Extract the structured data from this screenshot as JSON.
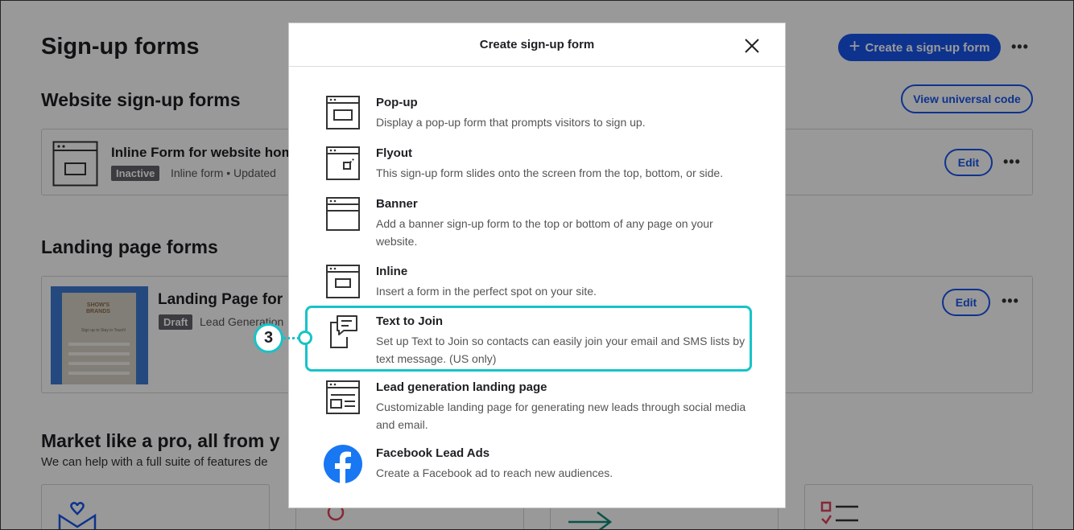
{
  "page": {
    "title": "Sign-up forms",
    "create_button": "Create a sign-up form",
    "more": "•••",
    "website_section": {
      "heading": "Website sign-up forms",
      "view_code_button": "View universal code",
      "form": {
        "name": "Inline Form for website homep",
        "status": "Inactive",
        "meta": "Inline form • Updated",
        "edit": "Edit"
      }
    },
    "landing_section": {
      "heading": "Landing page forms",
      "form": {
        "name": "Landing Page for",
        "status": "Draft",
        "meta": "Lead Generation",
        "edit": "Edit",
        "thumb_title": "SHOW'S\nBRANDS",
        "thumb_text": "Sign up to Stay in Touch!"
      }
    },
    "market": {
      "heading": "Market like a pro, all from y",
      "subtitle": "We can help with a full suite of features de"
    }
  },
  "modal": {
    "title": "Create sign-up form",
    "close_icon": "close-icon",
    "options": [
      {
        "title": "Pop-up",
        "desc": "Display a pop-up form that prompts visitors to sign up.",
        "icon": "popup-icon"
      },
      {
        "title": "Flyout",
        "desc": "This sign-up form slides onto the screen from the top, bottom, or side.",
        "icon": "flyout-icon"
      },
      {
        "title": "Banner",
        "desc": "Add a banner sign-up form to the top or bottom of any page on your website.",
        "icon": "banner-icon"
      },
      {
        "title": "Inline",
        "desc": "Insert a form in the perfect spot on your site.",
        "icon": "inline-icon"
      },
      {
        "title": "Text to Join",
        "desc": "Set up Text to Join so contacts can easily join your email and SMS lists by text message. (US only)",
        "icon": "text-to-join-icon"
      },
      {
        "title": "Lead generation landing page",
        "desc": "Customizable landing page for generating new leads through social media and email.",
        "icon": "landing-page-icon"
      },
      {
        "title": "Facebook Lead Ads",
        "desc": "Create a Facebook ad to reach new audiences.",
        "icon": "facebook-icon"
      }
    ]
  },
  "callout": {
    "step": "3"
  },
  "colors": {
    "accent": "#1856ed",
    "highlight": "#17c3c8",
    "facebook": "#1877f2"
  }
}
